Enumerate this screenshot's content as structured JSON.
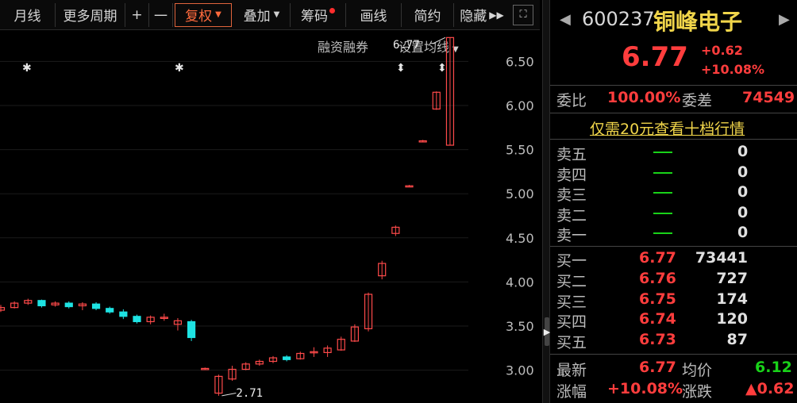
{
  "toolbar": {
    "items": [
      {
        "label": "月线"
      },
      {
        "label": "更多周期"
      },
      {
        "label": "+"
      },
      {
        "label": "一"
      },
      {
        "label": "复权"
      },
      {
        "label": "叠加"
      },
      {
        "label": "筹码"
      },
      {
        "label": "画线"
      },
      {
        "label": "简约"
      },
      {
        "label": "隐藏"
      }
    ],
    "active_color": "#ff6a3d"
  },
  "chart": {
    "sub_left": "融资融券",
    "sub_right": "设置均线",
    "high_label": "6.77",
    "low_label": "2.71",
    "y_ticks": [
      "6.50",
      "6.00",
      "5.50",
      "5.00",
      "4.50",
      "4.00",
      "3.50",
      "3.00"
    ]
  },
  "chart_data": {
    "type": "candlestick",
    "ylim": [
      2.7,
      6.8
    ],
    "up_color": "#ff4a4a",
    "down_color": "#1ee3e3",
    "candles": [
      {
        "o": 3.68,
        "h": 3.74,
        "l": 3.66,
        "c": 3.71
      },
      {
        "o": 3.71,
        "h": 3.78,
        "l": 3.7,
        "c": 3.76
      },
      {
        "o": 3.76,
        "h": 3.81,
        "l": 3.74,
        "c": 3.79
      },
      {
        "o": 3.79,
        "h": 3.8,
        "l": 3.71,
        "c": 3.73
      },
      {
        "o": 3.74,
        "h": 3.78,
        "l": 3.72,
        "c": 3.76
      },
      {
        "o": 3.76,
        "h": 3.78,
        "l": 3.7,
        "c": 3.72
      },
      {
        "o": 3.73,
        "h": 3.77,
        "l": 3.68,
        "c": 3.75
      },
      {
        "o": 3.75,
        "h": 3.77,
        "l": 3.68,
        "c": 3.7
      },
      {
        "o": 3.7,
        "h": 3.72,
        "l": 3.64,
        "c": 3.66
      },
      {
        "o": 3.66,
        "h": 3.69,
        "l": 3.58,
        "c": 3.61
      },
      {
        "o": 3.61,
        "h": 3.63,
        "l": 3.53,
        "c": 3.55
      },
      {
        "o": 3.55,
        "h": 3.62,
        "l": 3.52,
        "c": 3.6
      },
      {
        "o": 3.6,
        "h": 3.64,
        "l": 3.56,
        "c": 3.6
      },
      {
        "o": 3.52,
        "h": 3.59,
        "l": 3.45,
        "c": 3.56
      },
      {
        "o": 3.55,
        "h": 3.57,
        "l": 3.33,
        "c": 3.37
      },
      {
        "o": 3.02,
        "h": 3.03,
        "l": 3.01,
        "c": 3.02
      },
      {
        "o": 2.74,
        "h": 2.95,
        "l": 2.71,
        "c": 2.93
      },
      {
        "o": 2.9,
        "h": 3.05,
        "l": 2.88,
        "c": 3.01
      },
      {
        "o": 3.01,
        "h": 3.09,
        "l": 3.0,
        "c": 3.07
      },
      {
        "o": 3.07,
        "h": 3.12,
        "l": 3.05,
        "c": 3.1
      },
      {
        "o": 3.1,
        "h": 3.16,
        "l": 3.08,
        "c": 3.14
      },
      {
        "o": 3.15,
        "h": 3.17,
        "l": 3.1,
        "c": 3.12
      },
      {
        "o": 3.13,
        "h": 3.21,
        "l": 3.12,
        "c": 3.19
      },
      {
        "o": 3.2,
        "h": 3.26,
        "l": 3.15,
        "c": 3.21
      },
      {
        "o": 3.2,
        "h": 3.28,
        "l": 3.15,
        "c": 3.25
      },
      {
        "o": 3.23,
        "h": 3.38,
        "l": 3.22,
        "c": 3.35
      },
      {
        "o": 3.33,
        "h": 3.52,
        "l": 3.32,
        "c": 3.49
      },
      {
        "o": 3.47,
        "h": 3.88,
        "l": 3.44,
        "c": 3.86
      },
      {
        "o": 4.07,
        "h": 4.24,
        "l": 4.03,
        "c": 4.21
      },
      {
        "o": 4.55,
        "h": 4.64,
        "l": 4.52,
        "c": 4.62
      },
      {
        "o": 5.09,
        "h": 5.1,
        "l": 5.08,
        "c": 5.09
      },
      {
        "o": 5.6,
        "h": 5.61,
        "l": 5.59,
        "c": 5.6
      },
      {
        "o": 5.96,
        "h": 6.16,
        "l": 5.95,
        "c": 6.15
      },
      {
        "o": 5.55,
        "h": 6.77,
        "l": 5.55,
        "c": 6.77
      }
    ]
  },
  "quote": {
    "code": "600237",
    "name": "铜峰电子",
    "price": "6.77",
    "change": "+0.62",
    "change_pct": "+10.08%",
    "weibi_label": "委比",
    "weibi_value": "100.00%",
    "weicha_label": "委差",
    "weicha_value": "74549",
    "ten_level_link": "仅需20元查看十档行情",
    "sells": [
      {
        "label": "卖五",
        "qty": "0"
      },
      {
        "label": "卖四",
        "qty": "0"
      },
      {
        "label": "卖三",
        "qty": "0"
      },
      {
        "label": "卖二",
        "qty": "0"
      },
      {
        "label": "卖一",
        "qty": "0"
      }
    ],
    "buys": [
      {
        "label": "买一",
        "price": "6.77",
        "qty": "73441"
      },
      {
        "label": "买二",
        "price": "6.76",
        "qty": "727"
      },
      {
        "label": "买三",
        "price": "6.75",
        "qty": "174"
      },
      {
        "label": "买四",
        "price": "6.74",
        "qty": "120"
      },
      {
        "label": "买五",
        "price": "6.73",
        "qty": "87"
      }
    ],
    "latest_label": "最新",
    "latest_value": "6.77",
    "avg_label": "均价",
    "avg_value": "6.12",
    "pct_label": "涨幅",
    "pct_value": "+10.08%",
    "chg_label": "涨跌",
    "chg_value": "▲0.62"
  }
}
